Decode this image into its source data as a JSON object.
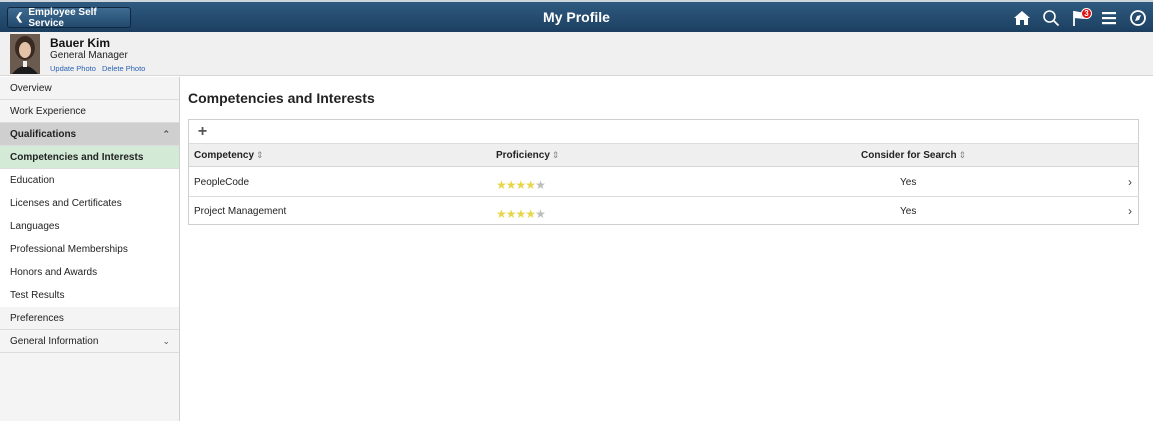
{
  "header": {
    "back_label": "Employee Self Service",
    "title": "My Profile",
    "notification_count": "3",
    "icons": [
      "home-icon",
      "search-icon",
      "notification-flag-icon",
      "actions-menu-icon",
      "navbar-icon"
    ]
  },
  "profile": {
    "name": "Bauer Kim",
    "job_title": "General Manager",
    "update_photo": "Update Photo",
    "delete_photo": "Delete Photo"
  },
  "sidebar": {
    "items": [
      {
        "label": "Overview"
      },
      {
        "label": "Work Experience"
      },
      {
        "label": "Qualifications"
      },
      {
        "label": "Competencies and Interests"
      },
      {
        "label": "Education"
      },
      {
        "label": "Licenses and Certificates"
      },
      {
        "label": "Languages"
      },
      {
        "label": "Professional Memberships"
      },
      {
        "label": "Honors and Awards"
      },
      {
        "label": "Test Results"
      },
      {
        "label": "Preferences"
      },
      {
        "label": "General Information"
      }
    ]
  },
  "main": {
    "section_title": "Competencies and Interests",
    "columns": [
      "Competency",
      "Proficiency",
      "Consider for Search"
    ],
    "rows": [
      {
        "competency": "PeopleCode",
        "proficiency_stars": 4,
        "max_stars": 5,
        "consider_for_search": "Yes"
      },
      {
        "competency": "Project Management",
        "proficiency_stars": 4,
        "max_stars": 5,
        "consider_for_search": "Yes"
      }
    ]
  },
  "colors": {
    "header_bar": "#1c3f60",
    "selected_nav": "#d3ead7",
    "group_nav": "#cfcfcf",
    "star_filled": "#e8d64a",
    "star_empty": "#bdbdbd",
    "link": "#2a62b5",
    "badge": "#dd1111"
  }
}
